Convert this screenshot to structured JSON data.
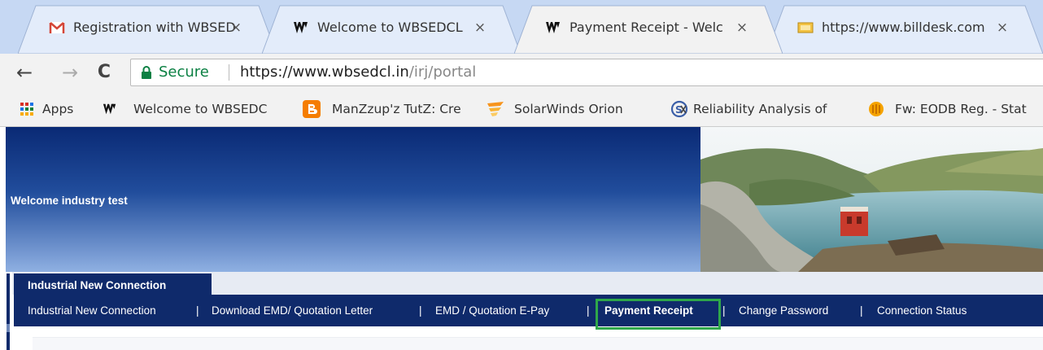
{
  "browser": {
    "tabs": [
      {
        "title": "Registration with WBSED",
        "favicon": "gmail-icon",
        "active": false
      },
      {
        "title": "Welcome to WBSEDCL",
        "favicon": "wbsedcl-logo-icon",
        "active": false
      },
      {
        "title": "Payment Receipt - Welc",
        "favicon": "wbsedcl-logo-icon",
        "active": true
      },
      {
        "title": "https://www.billdesk.com",
        "favicon": "billdesk-icon",
        "active": false
      }
    ],
    "tab_close_glyph": "×",
    "nav": {
      "back": "←",
      "forward": "→",
      "reload": "C"
    },
    "omnibox": {
      "secure_label": "Secure",
      "url_host": "https://www.wbsedcl.in",
      "url_path": "/irj/portal"
    },
    "bookmarks": [
      {
        "label": "Apps",
        "icon": "apps-grid-icon"
      },
      {
        "label": "Welcome to WBSEDC",
        "icon": "wbsedcl-logo-icon"
      },
      {
        "label": "ManZzup'z TutZ: Cre",
        "icon": "blogger-icon"
      },
      {
        "label": "SolarWinds Orion",
        "icon": "solarwinds-icon"
      },
      {
        "label": "Reliability Analysis of",
        "icon": "reliability-icon"
      },
      {
        "label": "Fw: EODB Reg. - Stat",
        "icon": "honey-icon"
      }
    ]
  },
  "page": {
    "welcome": "Welcome industry test",
    "subnav_tab": "Industrial New Connection",
    "menu": [
      {
        "label": "Industrial New Connection",
        "active": false
      },
      {
        "label": "Download EMD/ Quotation Letter",
        "active": false
      },
      {
        "label": "EMD / Quotation E-Pay",
        "active": false
      },
      {
        "label": "Payment Receipt",
        "active": true
      },
      {
        "label": "Change Password",
        "active": false
      },
      {
        "label": "Connection Status",
        "active": false
      }
    ],
    "menu_separator": "|"
  },
  "colors": {
    "navy": "#0f2a6b",
    "highlight": "#2fa74a",
    "secure_green": "#0b8043",
    "tab_strip": "#c6d8f3"
  }
}
